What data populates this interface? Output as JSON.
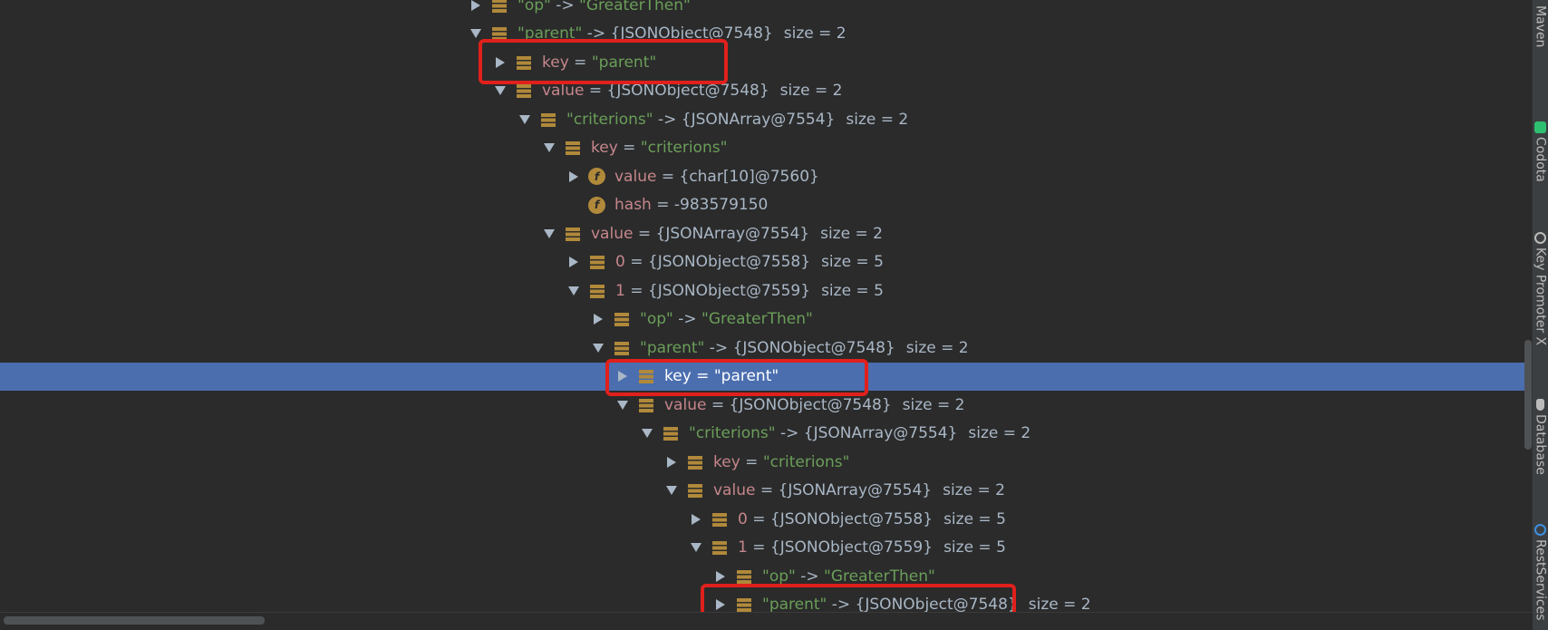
{
  "tree": {
    "rows": [
      {
        "toggle": "right",
        "icon": "field-list",
        "name": "\"op\"",
        "name_str": true,
        "sep": " -> ",
        "value": "\"GreaterThen\"",
        "value_str": true,
        "size": ""
      },
      {
        "toggle": "down",
        "icon": "field-list",
        "name": "\"parent\"",
        "name_str": true,
        "sep": " -> ",
        "value": "{JSONObject@7548}",
        "value_str": false,
        "size": "size = 2"
      },
      {
        "toggle": "right",
        "icon": "field-list",
        "name": "key",
        "name_str": false,
        "sep": " = ",
        "value": "\"parent\"",
        "value_str": true,
        "size": ""
      },
      {
        "toggle": "down",
        "icon": "field-list",
        "name": "value",
        "name_str": false,
        "sep": " = ",
        "value": "{JSONObject@7548}",
        "value_str": false,
        "size": "size = 2"
      },
      {
        "toggle": "down",
        "icon": "field-list",
        "name": "\"criterions\"",
        "name_str": true,
        "sep": " -> ",
        "value": "{JSONArray@7554}",
        "value_str": false,
        "size": "size = 2"
      },
      {
        "toggle": "down",
        "icon": "field-list",
        "name": "key",
        "name_str": false,
        "sep": " = ",
        "value": "\"criterions\"",
        "value_str": true,
        "size": ""
      },
      {
        "toggle": "right",
        "icon": "field-f",
        "icon_label": "f",
        "name": "value",
        "name_str": false,
        "sep": " = ",
        "value": "{char[10]@7560}",
        "value_str": false,
        "size": ""
      },
      {
        "toggle": "none",
        "icon": "field-f",
        "icon_label": "f",
        "name": "hash",
        "name_str": false,
        "sep": " = ",
        "value": "-983579150",
        "value_str": false,
        "size": ""
      },
      {
        "toggle": "down",
        "icon": "field-list",
        "name": "value",
        "name_str": false,
        "sep": " = ",
        "value": "{JSONArray@7554}",
        "value_str": false,
        "size": "size = 2"
      },
      {
        "toggle": "right",
        "icon": "field-list",
        "name": "0",
        "name_str": false,
        "sep": " = ",
        "value": "{JSONObject@7558}",
        "value_str": false,
        "size": "size = 5"
      },
      {
        "toggle": "down",
        "icon": "field-list",
        "name": "1",
        "name_str": false,
        "sep": " = ",
        "value": "{JSONObject@7559}",
        "value_str": false,
        "size": "size = 5"
      },
      {
        "toggle": "right",
        "icon": "field-list",
        "name": "\"op\"",
        "name_str": true,
        "sep": " -> ",
        "value": "\"GreaterThen\"",
        "value_str": true,
        "size": ""
      },
      {
        "toggle": "down",
        "icon": "field-list",
        "name": "\"parent\"",
        "name_str": true,
        "sep": " -> ",
        "value": "{JSONObject@7548}",
        "value_str": false,
        "size": "size = 2"
      },
      {
        "toggle": "right",
        "icon": "field-list",
        "name": "key",
        "name_str": false,
        "sep": " = ",
        "value": "\"parent\"",
        "value_str": true,
        "size": "",
        "selected": true
      },
      {
        "toggle": "down",
        "icon": "field-list",
        "name": "value",
        "name_str": false,
        "sep": " = ",
        "value": "{JSONObject@7548}",
        "value_str": false,
        "size": "size = 2"
      },
      {
        "toggle": "down",
        "icon": "field-list",
        "name": "\"criterions\"",
        "name_str": true,
        "sep": " -> ",
        "value": "{JSONArray@7554}",
        "value_str": false,
        "size": "size = 2"
      },
      {
        "toggle": "right",
        "icon": "field-list",
        "name": "key",
        "name_str": false,
        "sep": " = ",
        "value": "\"criterions\"",
        "value_str": true,
        "size": ""
      },
      {
        "toggle": "down",
        "icon": "field-list",
        "name": "value",
        "name_str": false,
        "sep": " = ",
        "value": "{JSONArray@7554}",
        "value_str": false,
        "size": "size = 2"
      },
      {
        "toggle": "right",
        "icon": "field-list",
        "name": "0",
        "name_str": false,
        "sep": " = ",
        "value": "{JSONObject@7558}",
        "value_str": false,
        "size": "size = 5"
      },
      {
        "toggle": "down",
        "icon": "field-list",
        "name": "1",
        "name_str": false,
        "sep": " = ",
        "value": "{JSONObject@7559}",
        "value_str": false,
        "size": "size = 5"
      },
      {
        "toggle": "right",
        "icon": "field-list",
        "name": "\"op\"",
        "name_str": true,
        "sep": " -> ",
        "value": "\"GreaterThen\"",
        "value_str": true,
        "size": ""
      },
      {
        "toggle": "right",
        "icon": "field-list",
        "name": "\"parent\"",
        "name_str": true,
        "sep": " -> ",
        "value": "{JSONObject@7548}",
        "value_str": false,
        "size": "size = 2"
      }
    ]
  },
  "right_tabs": [
    {
      "label": "Maven",
      "icon": "maven-icon"
    },
    {
      "label": "Codota",
      "icon": "codota-icon"
    },
    {
      "label": "Key Promoter X",
      "icon": "key-promoter-icon"
    },
    {
      "label": "Database",
      "icon": "database-icon"
    },
    {
      "label": "RestServices",
      "icon": "rest-services-icon"
    }
  ],
  "colors": {
    "background": "#2b2b2b",
    "selection": "#4b6eaf",
    "highlight_box": "#e0201c",
    "name": "#c5868b",
    "string": "#6a9e59",
    "plain": "#a9b7c6",
    "icon": "#b0893a"
  }
}
